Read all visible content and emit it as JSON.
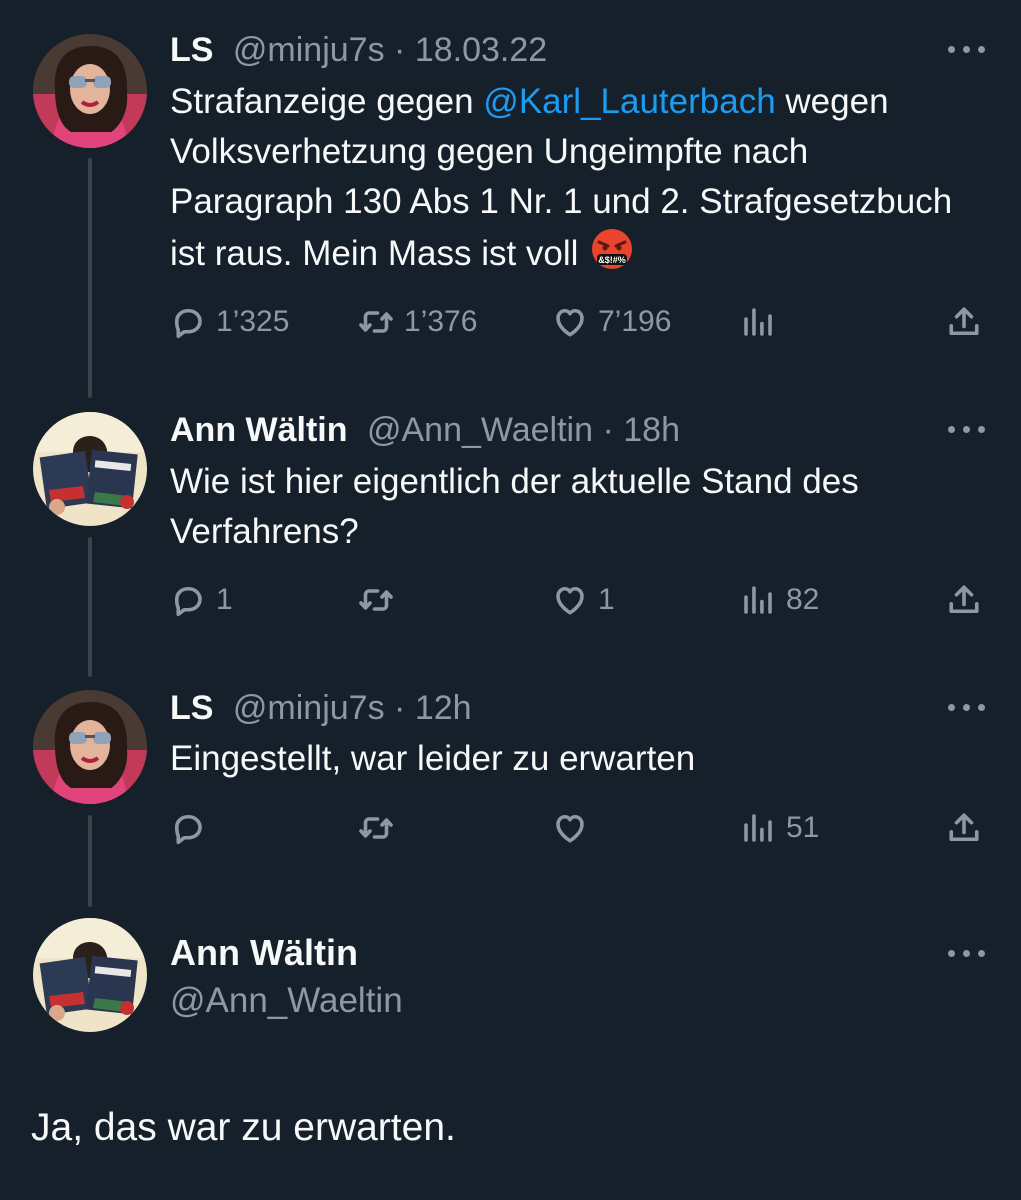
{
  "tweets": [
    {
      "name": "LS",
      "handle": "@minju7s",
      "sep": "·",
      "time": "18.03.22",
      "text_pre": "Strafanzeige gegen ",
      "mention": "@Karl_Lauterbach",
      "text_post": " wegen Volksverhetzung gegen Ungeimpfte nach Paragraph 130 Abs 1 Nr. 1 und 2. Strafgesetzbuch ist raus. Mein Mass ist voll",
      "emoji": "cursing-face-emoji",
      "replies": "1’325",
      "retweets": "1’376",
      "likes": "7’196",
      "views": ""
    },
    {
      "name": "Ann Wältin",
      "handle": "@Ann_Waeltin",
      "sep": "·",
      "time": "18h",
      "text": "Wie ist hier eigentlich der aktuelle Stand des Verfahrens?",
      "replies": "1",
      "retweets": "",
      "likes": "1",
      "views": "82"
    },
    {
      "name": "LS",
      "handle": "@minju7s",
      "sep": "·",
      "time": "12h",
      "text": "Eingestellt, war leider zu erwarten",
      "replies": "",
      "retweets": "",
      "likes": "",
      "views": "51"
    }
  ],
  "main_tweet": {
    "name": "Ann Wältin",
    "handle": "@Ann_Waeltin",
    "text": "Ja, das war zu erwarten."
  },
  "colors": {
    "background": "#15202b",
    "text": "#f7f9f9",
    "muted": "#8b98a5",
    "link": "#1d9bf0",
    "thread_line": "#38444d"
  },
  "icons": [
    "reply-icon",
    "retweet-icon",
    "like-icon",
    "views-icon",
    "share-icon",
    "more-icon"
  ]
}
